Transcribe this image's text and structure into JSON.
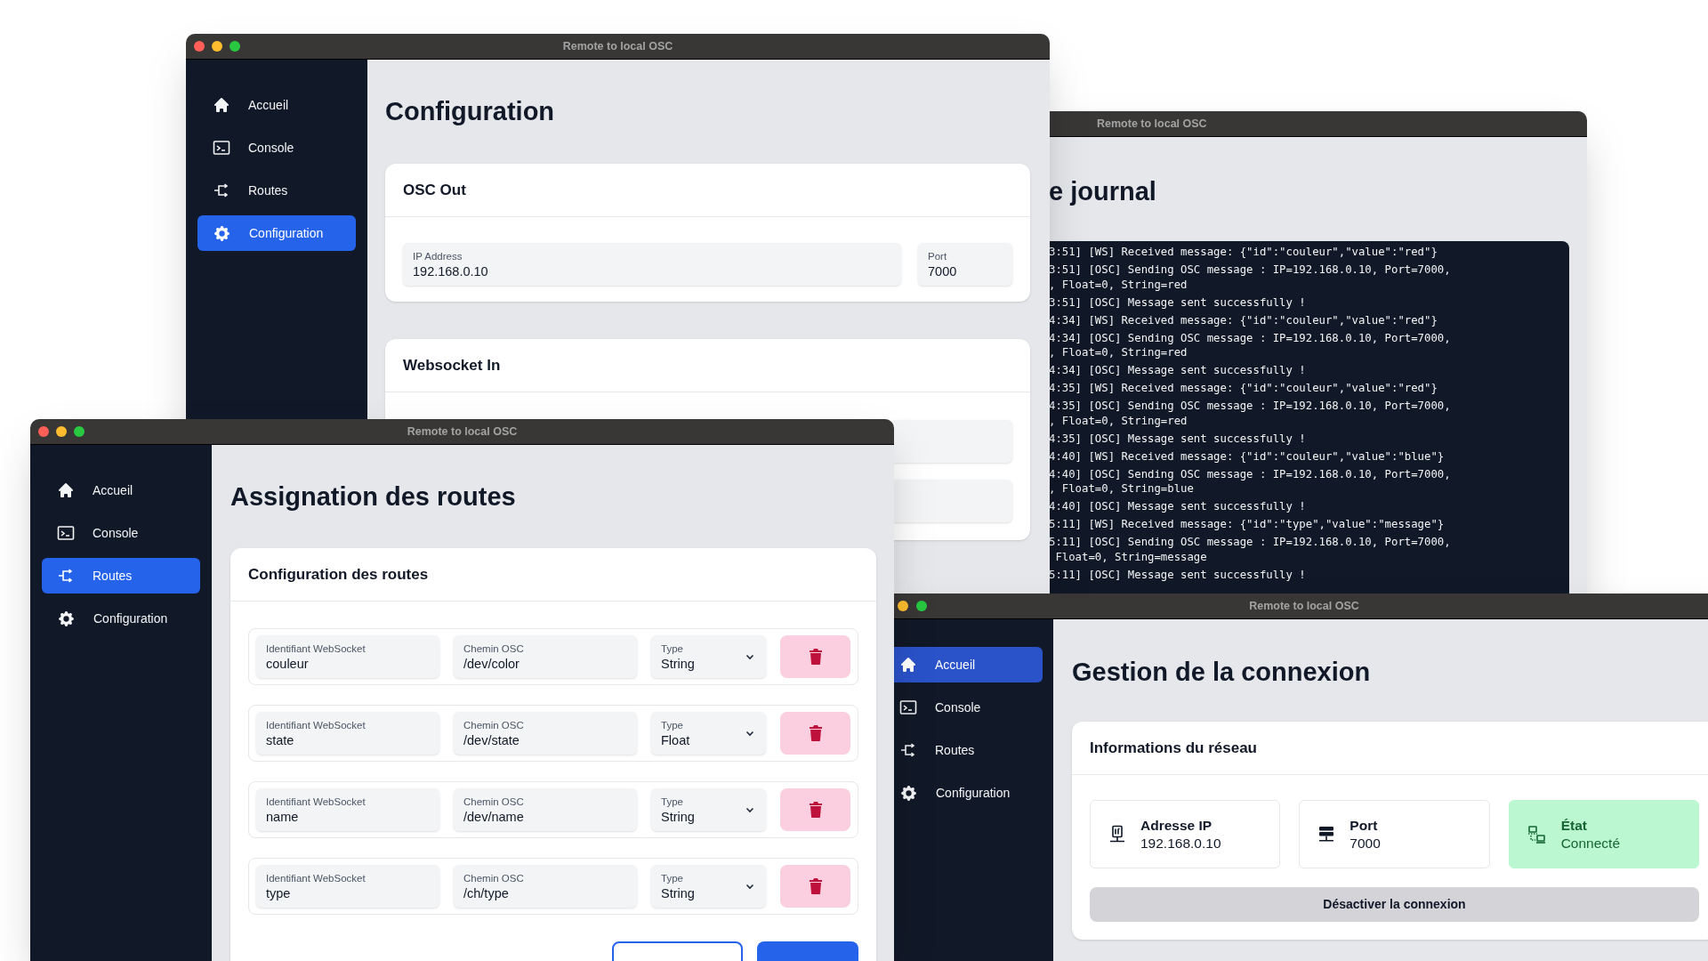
{
  "windows": [
    {
      "kind": "console",
      "title": "Remote to local OSC",
      "heading": "e journal",
      "log": [
        [
          "3:51] [WS] Received message: {\"id\":\"couleur\",\"value\":\"red\"}"
        ],
        [
          "3:51] [OSC] Sending OSC message : IP=192.168.0.10, Port=7000,",
          ", Float=0, String=red"
        ],
        [
          "3:51] [OSC] Message sent successfully !"
        ],
        [
          "4:34] [WS] Received message: {\"id\":\"couleur\",\"value\":\"red\"}"
        ],
        [
          "4:34] [OSC] Sending OSC message : IP=192.168.0.10, Port=7000,",
          ", Float=0, String=red"
        ],
        [
          "4:34] [OSC] Message sent successfully !"
        ],
        [
          "4:35] [WS] Received message: {\"id\":\"couleur\",\"value\":\"red\"}"
        ],
        [
          "4:35] [OSC] Sending OSC message : IP=192.168.0.10, Port=7000,",
          ", Float=0, String=red"
        ],
        [
          "4:35] [OSC] Message sent successfully !"
        ],
        [
          "4:40] [WS] Received message: {\"id\":\"couleur\",\"value\":\"blue\"}"
        ],
        [
          "4:40] [OSC] Sending OSC message : IP=192.168.0.10, Port=7000,",
          ", Float=0, String=blue"
        ],
        [
          "4:40] [OSC] Message sent successfully !"
        ],
        [
          "5:11] [WS] Received message: {\"id\":\"type\",\"value\":\"message\"}"
        ],
        [
          "5:11] [OSC] Sending OSC message : IP=192.168.0.10, Port=7000,",
          " Float=0, String=message"
        ],
        [
          "5:11] [OSC] Message sent successfully !"
        ]
      ]
    },
    {
      "kind": "configuration",
      "title": "Remote to local OSC",
      "sidebar": [
        {
          "label": "Accueil",
          "selected": false
        },
        {
          "label": "Console",
          "selected": false
        },
        {
          "label": "Routes",
          "selected": false
        },
        {
          "label": "Configuration",
          "selected": true
        }
      ],
      "heading": "Configuration",
      "cards": [
        {
          "title": "OSC Out",
          "fields": [
            {
              "label": "IP Address",
              "value": "192.168.0.10"
            },
            {
              "label": "Port",
              "value": "7000"
            }
          ]
        },
        {
          "title": "Websocket In"
        }
      ]
    },
    {
      "kind": "connection",
      "title": "Remote to local OSC",
      "sidebar": [
        {
          "label": "Accueil",
          "selected": true
        },
        {
          "label": "Console",
          "selected": false
        },
        {
          "label": "Routes",
          "selected": false
        },
        {
          "label": "Configuration",
          "selected": false
        }
      ],
      "heading": "Gestion de la connexion",
      "card_title": "Informations du réseau",
      "tiles": [
        {
          "label": "Adresse IP",
          "value": "192.168.0.10",
          "active": false
        },
        {
          "label": "Port",
          "value": "7000",
          "active": false
        },
        {
          "label": "État",
          "value": "Connecté",
          "active": true
        }
      ],
      "button": "Désactiver la connexion"
    },
    {
      "kind": "routes",
      "title": "Remote to local OSC",
      "sidebar": [
        {
          "label": "Accueil",
          "selected": false
        },
        {
          "label": "Console",
          "selected": false
        },
        {
          "label": "Routes",
          "selected": true
        },
        {
          "label": "Configuration",
          "selected": false
        }
      ],
      "heading": "Assignation des routes",
      "card_title": "Configuration des routes",
      "rows": [
        {
          "fields": [
            {
              "label": "Identifiant WebSocket",
              "value": "couleur"
            },
            {
              "label": "Chemin OSC",
              "value": "/dev/color"
            }
          ],
          "type": {
            "label": "Type",
            "value": "String"
          }
        },
        {
          "fields": [
            {
              "label": "Identifiant WebSocket",
              "value": "state"
            },
            {
              "label": "Chemin OSC",
              "value": "/dev/state"
            }
          ],
          "type": {
            "label": "Type",
            "value": "Float"
          }
        },
        {
          "fields": [
            {
              "label": "Identifiant WebSocket",
              "value": "name"
            },
            {
              "label": "Chemin OSC",
              "value": "/dev/name"
            }
          ],
          "type": {
            "label": "Type",
            "value": "String"
          }
        },
        {
          "fields": [
            {
              "label": "Identifiant WebSocket",
              "value": "type"
            },
            {
              "label": "Chemin OSC",
              "value": "/ch/type"
            }
          ],
          "type": {
            "label": "Type",
            "value": "String"
          }
        }
      ],
      "footer_buttons": [
        {
          "kind": "outline"
        },
        {
          "kind": "primary"
        }
      ]
    }
  ]
}
